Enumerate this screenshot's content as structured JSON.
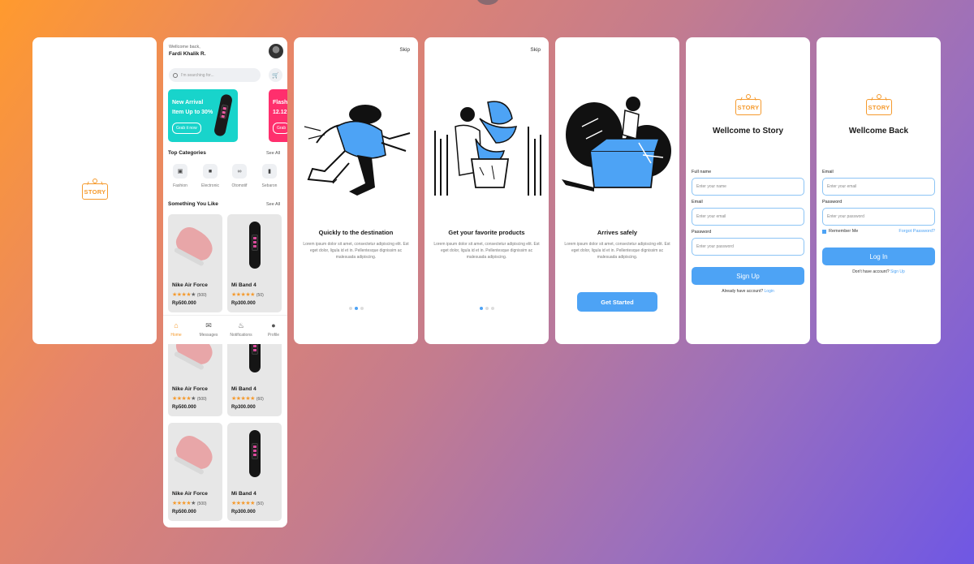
{
  "logo_text": "STORY",
  "accent_color": "#4da3f5",
  "brand_color": "#f59a2d",
  "home": {
    "welcome": "Wellcome back,",
    "user_name": "Fardi Khalik R.",
    "search_placeholder": "I'm searching for...",
    "banners": [
      {
        "line1": "New Arrival",
        "line2": "Item Up to 30%",
        "cta": "Grab it now"
      },
      {
        "line1": "Flash",
        "line2": "12.12",
        "cta": "Grab"
      }
    ],
    "top_categories_title": "Top Categories",
    "see_all": "See All",
    "categories": [
      "Fashion",
      "Electronic",
      "Otomotif",
      "Sebaron"
    ],
    "something_title": "Something You Like",
    "products": [
      {
        "name": "Nike Air Force",
        "reviews": "(500)",
        "price": "Rp500.000",
        "rating": 4
      },
      {
        "name": "Mi Band 4",
        "reviews": "(50)",
        "price": "Rp300.000",
        "rating": 5
      },
      {
        "name": "Nike Air Force",
        "reviews": "(500)",
        "price": "Rp500.000",
        "rating": 4
      },
      {
        "name": "Mi Band 4",
        "reviews": "(60)",
        "price": "Rp300.000",
        "rating": 5
      },
      {
        "name": "Nike Air Force",
        "reviews": "(500)",
        "price": "Rp500.000",
        "rating": 4
      },
      {
        "name": "Mi Band 4",
        "reviews": "(50)",
        "price": "Rp300.000",
        "rating": 5
      }
    ],
    "tabs": [
      "Home",
      "Messages",
      "Notifications",
      "Profile"
    ]
  },
  "onboarding": [
    {
      "skip": "Skip",
      "title": "Quickly to the destination",
      "text": "Lorem ipsum dolor sit amet, consectetur adipiscing elit. Est eget dolor, ligula id et in. Pellentesque dignissim ac malesuada adipiscing."
    },
    {
      "skip": "Skip",
      "title": "Get your favorite products",
      "text": "Lorem ipsum dolor sit amet, consectetur adipiscing elit. Est eget dolor, ligula id et in. Pellentesque dignissim ac malesuada adipiscing."
    },
    {
      "title": "Arrives safely",
      "text": "Lorem ipsum dolor sit amet, consectetur adipiscing elit. Est eget dolor, ligula id et in. Pellentesque dignissim ac malesuada adipiscing.",
      "cta": "Get Started"
    }
  ],
  "signup": {
    "title": "Wellcome to Story",
    "fullname_label": "Full name",
    "fullname_placeholder": "Enter your name",
    "email_label": "Email",
    "email_placeholder": "Enter your email",
    "password_label": "Password",
    "password_placeholder": "Enter your password",
    "button": "Sign Up",
    "footer_text": "Already have account?",
    "footer_link": "Login"
  },
  "login": {
    "title": "Wellcome Back",
    "email_label": "Email",
    "email_placeholder": "Enter your email",
    "password_label": "Password",
    "password_placeholder": "Enter your password",
    "remember": "Remember Me",
    "forgot": "Forgot Password?",
    "button": "Log In",
    "footer_text": "Don't have account?",
    "footer_link": "Sign Up"
  }
}
